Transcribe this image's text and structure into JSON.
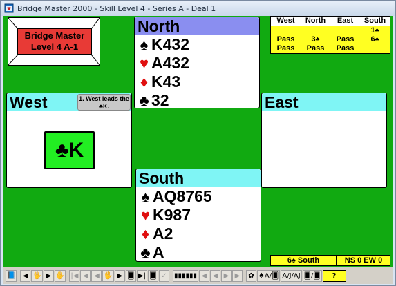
{
  "window": {
    "title": "Bridge Master 2000 - Skill Level 4 - Series A - Deal 1",
    "icon": "bridge-master-app-icon"
  },
  "logo": {
    "line1": "Bridge Master",
    "line2": "Level 4 A-1"
  },
  "hands": {
    "north": {
      "name": "North",
      "suits": [
        {
          "symbol": "♠",
          "cards": "K432",
          "color": "black"
        },
        {
          "symbol": "♥",
          "cards": "A432",
          "color": "red"
        },
        {
          "symbol": "♦",
          "cards": "K43",
          "color": "red"
        },
        {
          "symbol": "♣",
          "cards": "32",
          "color": "black"
        }
      ]
    },
    "south": {
      "name": "South",
      "suits": [
        {
          "symbol": "♠",
          "cards": "AQ8765",
          "color": "black"
        },
        {
          "symbol": "♥",
          "cards": "K987",
          "color": "red"
        },
        {
          "symbol": "♦",
          "cards": "A2",
          "color": "red"
        },
        {
          "symbol": "♣",
          "cards": "A",
          "color": "black"
        }
      ]
    },
    "west": {
      "name": "West",
      "lead_note": "1. West leads the ♣K.",
      "played_card": {
        "symbol": "♣",
        "rank": "K"
      }
    },
    "east": {
      "name": "East"
    }
  },
  "bidding": {
    "headers": [
      "West",
      "North",
      "East",
      "South"
    ],
    "rows": [
      [
        "",
        "",
        "",
        "1♠"
      ],
      [
        "Pass",
        "3♠",
        "Pass",
        "6♠"
      ],
      [
        "Pass",
        "Pass",
        "Pass",
        ""
      ]
    ]
  },
  "status": {
    "contract": "6♠ South",
    "score": "NS 0 EW 0"
  },
  "toolbar": {
    "buttons": [
      "📘",
      "◀",
      "🖐",
      "▶",
      "🖐",
      "|◀",
      "◀",
      "◀",
      "🖐",
      "▶",
      "🂠",
      "▶|",
      "🂠",
      "✓",
      "▮▮▮▮▮▮",
      "◀",
      "◀",
      "▶",
      "▶",
      "✿",
      "♠A/🂠",
      "A/J/AJ",
      "🂠/🂠",
      "?"
    ]
  }
}
